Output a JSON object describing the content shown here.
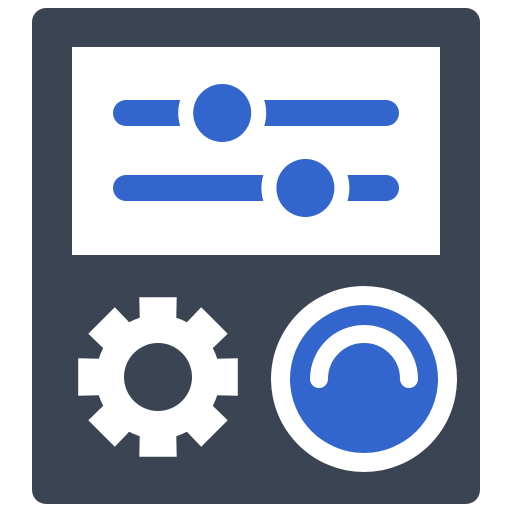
{
  "icon": {
    "name": "control-panel-icon",
    "colors": {
      "body": "#3b4453",
      "screen": "#ffffff",
      "accent": "#3366cc",
      "light": "#ffffff",
      "screen_cutout": "#ffffff"
    },
    "sliders": [
      {
        "name": "slider-top",
        "level": 0.37
      },
      {
        "name": "slider-bottom",
        "level": 0.69
      }
    ],
    "knob": {
      "name": "dial-knob",
      "arc_label": "level-arc-icon"
    },
    "gear": {
      "name": "gear-icon"
    }
  }
}
